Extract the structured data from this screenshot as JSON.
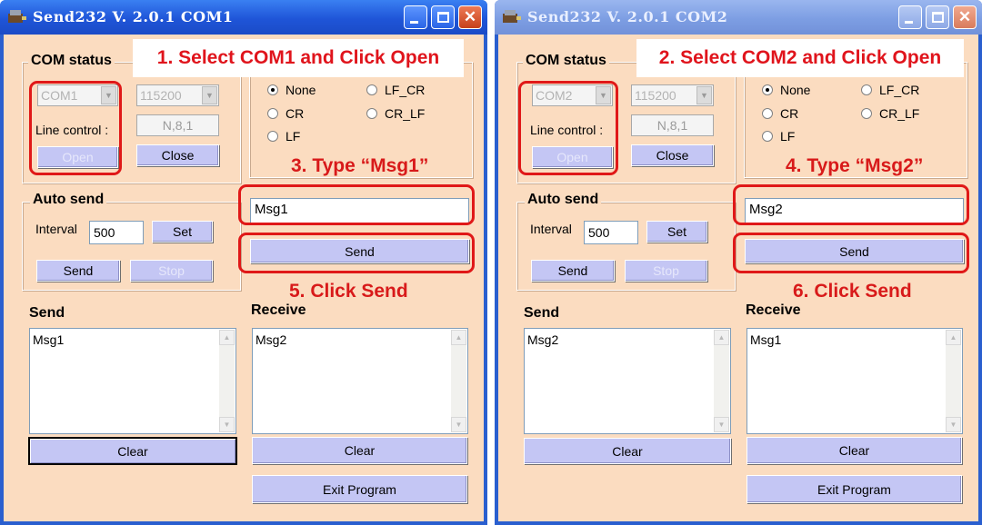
{
  "windows": [
    {
      "title": "Send232  V. 2.0.1  COM1",
      "callout_open": "1. Select COM1 and Click Open",
      "callout_type": "3. Type “Msg1”",
      "callout_send": "5. Click Send",
      "com_status": {
        "label": "COM status",
        "port": "COM1",
        "baud": "115200",
        "line_control_label": "Line control :",
        "line_control_value": "N,8,1",
        "open_label": "Open",
        "close_label": "Close"
      },
      "terminator": {
        "options": [
          "None",
          "LF_CR",
          "CR",
          "CR_LF",
          "LF"
        ],
        "selected": "None"
      },
      "message_input": "Msg1",
      "send_label": "Send",
      "auto_send": {
        "label": "Auto send",
        "interval_label": "Interval",
        "interval_value": "500",
        "set_label": "Set",
        "send_label": "Send",
        "stop_label": "Stop"
      },
      "send_area": {
        "label": "Send",
        "content": "Msg1",
        "clear_label": "Clear"
      },
      "receive_area": {
        "label": "Receive",
        "content": "Msg2",
        "clear_label": "Clear"
      },
      "exit_label": "Exit Program"
    },
    {
      "title": "Send232  V. 2.0.1  COM2",
      "callout_open": "2. Select COM2 and Click Open",
      "callout_type": "4. Type “Msg2”",
      "callout_send": "6. Click Send",
      "com_status": {
        "label": "COM status",
        "port": "COM2",
        "baud": "115200",
        "line_control_label": "Line control :",
        "line_control_value": "N,8,1",
        "open_label": "Open",
        "close_label": "Close"
      },
      "terminator": {
        "options": [
          "None",
          "LF_CR",
          "CR",
          "CR_LF",
          "LF"
        ],
        "selected": "None"
      },
      "message_input": "Msg2",
      "send_label": "Send",
      "auto_send": {
        "label": "Auto send",
        "interval_label": "Interval",
        "interval_value": "500",
        "set_label": "Set",
        "send_label": "Send",
        "stop_label": "Stop"
      },
      "send_area": {
        "label": "Send",
        "content": "Msg2",
        "clear_label": "Clear"
      },
      "receive_area": {
        "label": "Receive",
        "content": "Msg1",
        "clear_label": "Clear"
      },
      "exit_label": "Exit Program"
    }
  ],
  "colors": {
    "client_bg": "#fbdcc0",
    "button_bg": "#c4c6f4",
    "annotation_red": "#e01818",
    "titlebar_active": "#1f55d8",
    "titlebar_inactive": "#7d9ee3"
  }
}
